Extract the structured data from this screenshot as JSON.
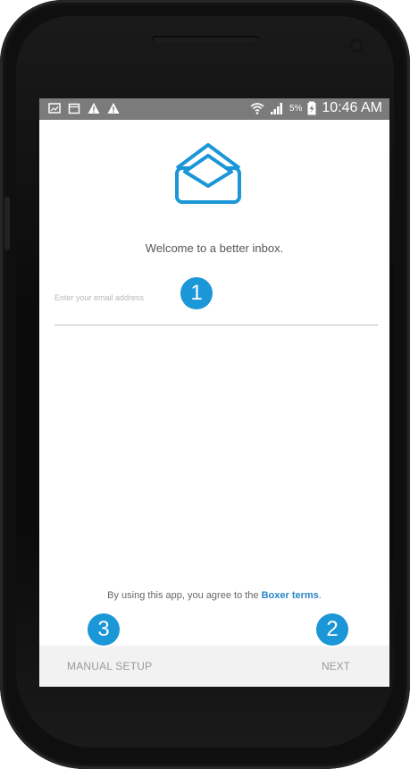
{
  "status_bar": {
    "icons_left": [
      "image-icon",
      "calendar-icon",
      "warning-icon",
      "warning-icon"
    ],
    "wifi_icon": "wifi-icon",
    "signal_icon": "signal-icon",
    "battery_percent": "5%",
    "battery_icon": "charging-battery-icon",
    "time": "10:46 AM"
  },
  "main": {
    "logo_icon": "open-envelope-icon",
    "welcome_text": "Welcome to a better inbox.",
    "email_placeholder": "Enter your email address"
  },
  "footer": {
    "terms_prefix": "By using this app, you agree to the",
    "terms_link": "Boxer terms",
    "terms_suffix": "."
  },
  "actions": {
    "manual_setup": "MANUAL SETUP",
    "next": "NEXT"
  },
  "callouts": {
    "one": "1",
    "two": "2",
    "three": "3"
  },
  "colors": {
    "accent": "#1b96d6",
    "link": "#2a86c4",
    "status_bar": "#7b7b7b"
  }
}
